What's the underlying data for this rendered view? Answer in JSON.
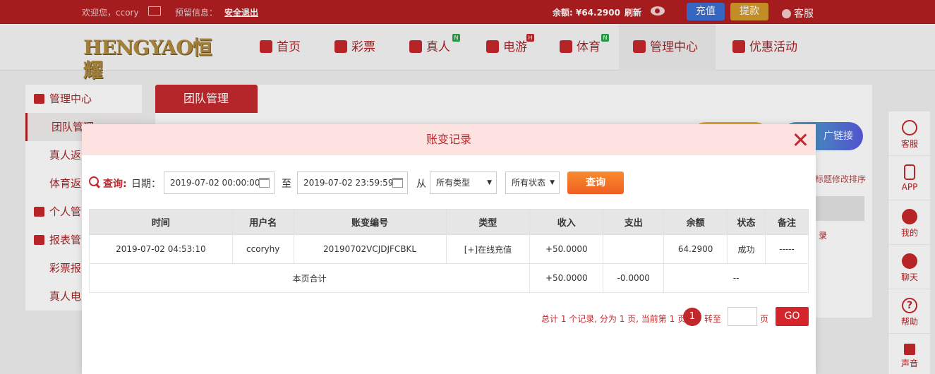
{
  "topbar": {
    "welcome": "欢迎您，ccory",
    "notice_label": "预留信息：",
    "logout": "安全退出",
    "balance": "余额: ¥64.2900",
    "refresh": "刷新",
    "recharge": "充值",
    "withdraw": "提款",
    "service": "客服"
  },
  "nav": {
    "logo": "HENGYAO恒耀",
    "items": [
      {
        "label": "首页"
      },
      {
        "label": "彩票"
      },
      {
        "label": "真人",
        "badge": "N"
      },
      {
        "label": "电游",
        "badge": "H"
      },
      {
        "label": "体育",
        "badge": "N"
      },
      {
        "label": "管理中心"
      },
      {
        "label": "优惠活动"
      }
    ]
  },
  "sidebar": {
    "items": [
      {
        "label": "管理中心"
      },
      {
        "label": "团队管理"
      },
      {
        "label": "真人返"
      },
      {
        "label": "体育返"
      },
      {
        "label": "个人管"
      },
      {
        "label": "报表管"
      },
      {
        "label": "彩票报"
      },
      {
        "label": "真人电"
      }
    ]
  },
  "content": {
    "tab": "团队管理",
    "promo_link": "广链接",
    "sort_hint": "标题修改排序",
    "row_text": "录"
  },
  "rightbar": {
    "items": [
      {
        "label": "客服"
      },
      {
        "label": "APP"
      },
      {
        "label": "我的"
      },
      {
        "label": "聊天"
      },
      {
        "label": "帮助"
      },
      {
        "label": "声音"
      }
    ]
  },
  "modal": {
    "title": "账变记录",
    "query": {
      "label": "查询:",
      "date_label": "日期：",
      "start": "2019-07-02 00:00:00",
      "to": "至",
      "end": "2019-07-02 23:59:59",
      "from": "从",
      "type_select": "所有类型",
      "status_select": "所有状态",
      "button": "查询"
    },
    "table": {
      "headers": [
        "时间",
        "用户名",
        "账变编号",
        "类型",
        "收入",
        "支出",
        "余额",
        "状态",
        "备注"
      ],
      "rows": [
        [
          "2019-07-02 04:53:10",
          "ccoryhy",
          "20190702VCJDJFCBKL",
          "[+]在线充值",
          "+50.0000",
          "",
          "64.2900",
          "成功",
          "-----"
        ]
      ],
      "summary": {
        "label": "本页合计",
        "income": "+50.0000",
        "expense": "-0.0000",
        "rest": "--"
      }
    },
    "pager": {
      "text": "总计 1 个记录, 分为 1 页, 当前第 1 页",
      "current": "1",
      "goto": "转至",
      "unit": "页",
      "go": "GO"
    }
  }
}
